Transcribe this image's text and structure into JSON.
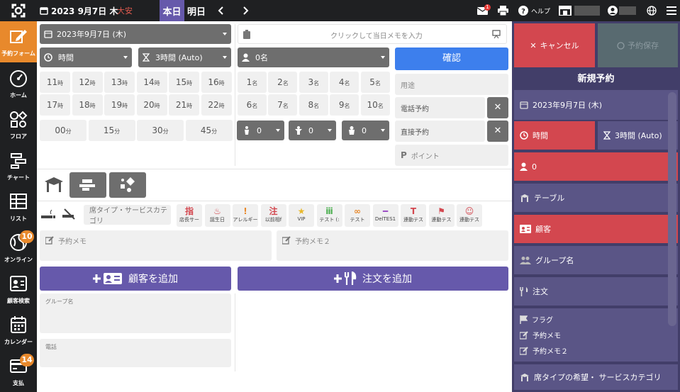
{
  "topbar": {
    "date": "2023 9月7日 木",
    "rokuyo": "大安",
    "today": "本日",
    "tomorrow": "明日",
    "mail_badge": "1",
    "help": "ヘルプ"
  },
  "nav": {
    "items": [
      {
        "label": "予約フォーム"
      },
      {
        "label": "ホーム"
      },
      {
        "label": "フロア"
      },
      {
        "label": "チャート"
      },
      {
        "label": "リスト"
      },
      {
        "label": "オンライン",
        "badge": "10"
      },
      {
        "label": "顧客検索"
      },
      {
        "label": "カレンダー"
      },
      {
        "label": "支払",
        "badge": "14"
      }
    ]
  },
  "form": {
    "date": "2023年9月7日 (木)",
    "memo_placeholder": "クリックして当日メモを入力",
    "time": "時間",
    "duration": "3時間 (Auto)",
    "people": "0名",
    "confirm": "確認",
    "hours": [
      "11",
      "12",
      "13",
      "14",
      "15",
      "16",
      "17",
      "18",
      "19",
      "20",
      "21",
      "22"
    ],
    "hour_unit": "時",
    "minutes": [
      "00",
      "15",
      "30",
      "45"
    ],
    "minute_unit": "分",
    "counts": [
      "1",
      "2",
      "3",
      "4",
      "5",
      "6",
      "7",
      "8",
      "9",
      "10"
    ],
    "count_unit": "名",
    "adult": "0",
    "child": "0",
    "baby": "0",
    "purpose": "用途",
    "phone_reservation": "電話予約",
    "direct_reservation": "直接予約",
    "point": "ポイント",
    "seat_category": "席タイプ・サービスカテゴリ",
    "tags": [
      {
        "icon": "指",
        "label": "店長サー",
        "color": "#d3474f"
      },
      {
        "icon": "♨",
        "label": "誕生日",
        "color": "#d3474f"
      },
      {
        "icon": "!",
        "label": "アレルギー",
        "color": "#e8892c"
      },
      {
        "icon": "注",
        "label": "以前相f",
        "color": "#d3474f"
      },
      {
        "icon": "★",
        "label": "VIP",
        "color": "#e8b82c"
      },
      {
        "icon": "ⅲ",
        "label": "テスト (:",
        "color": "#4caf50"
      },
      {
        "icon": "∞",
        "label": "テスト",
        "color": "#e8892c"
      },
      {
        "icon": "━",
        "label": "DelTES1",
        "color": "#9c4fc4"
      },
      {
        "icon": "T",
        "label": "連動テス",
        "color": "#d3474f"
      },
      {
        "icon": "⚑",
        "label": "連動テス",
        "color": "#d3474f"
      },
      {
        "icon": "☺",
        "label": "連動テス",
        "color": "#d3474f"
      }
    ],
    "memo1": "予約メモ",
    "memo2": "予約メモ２",
    "add_customer": "顧客を追加",
    "add_order": "注文を追加",
    "group_name": "グループ名",
    "phone": "電話"
  },
  "panel": {
    "cancel": "キャンセル",
    "save": "予約保存",
    "title": "新規予約",
    "date": "2023年9月7日 (木)",
    "time": "時間",
    "duration": "3時間 (Auto)",
    "people": "0",
    "table": "テーブル",
    "customer": "顧客",
    "group": "グループ名",
    "order": "注文",
    "flag": "フラグ",
    "memo1": "予約メモ",
    "memo2": "予約メモ２",
    "seat_category": "席タイプの希望・ サービスカテゴリ"
  },
  "colors": {
    "accent": "#e8892c",
    "primary": "#6659ab",
    "confirm": "#3d7fed",
    "danger": "#d3474f",
    "panel": "#423e69"
  }
}
